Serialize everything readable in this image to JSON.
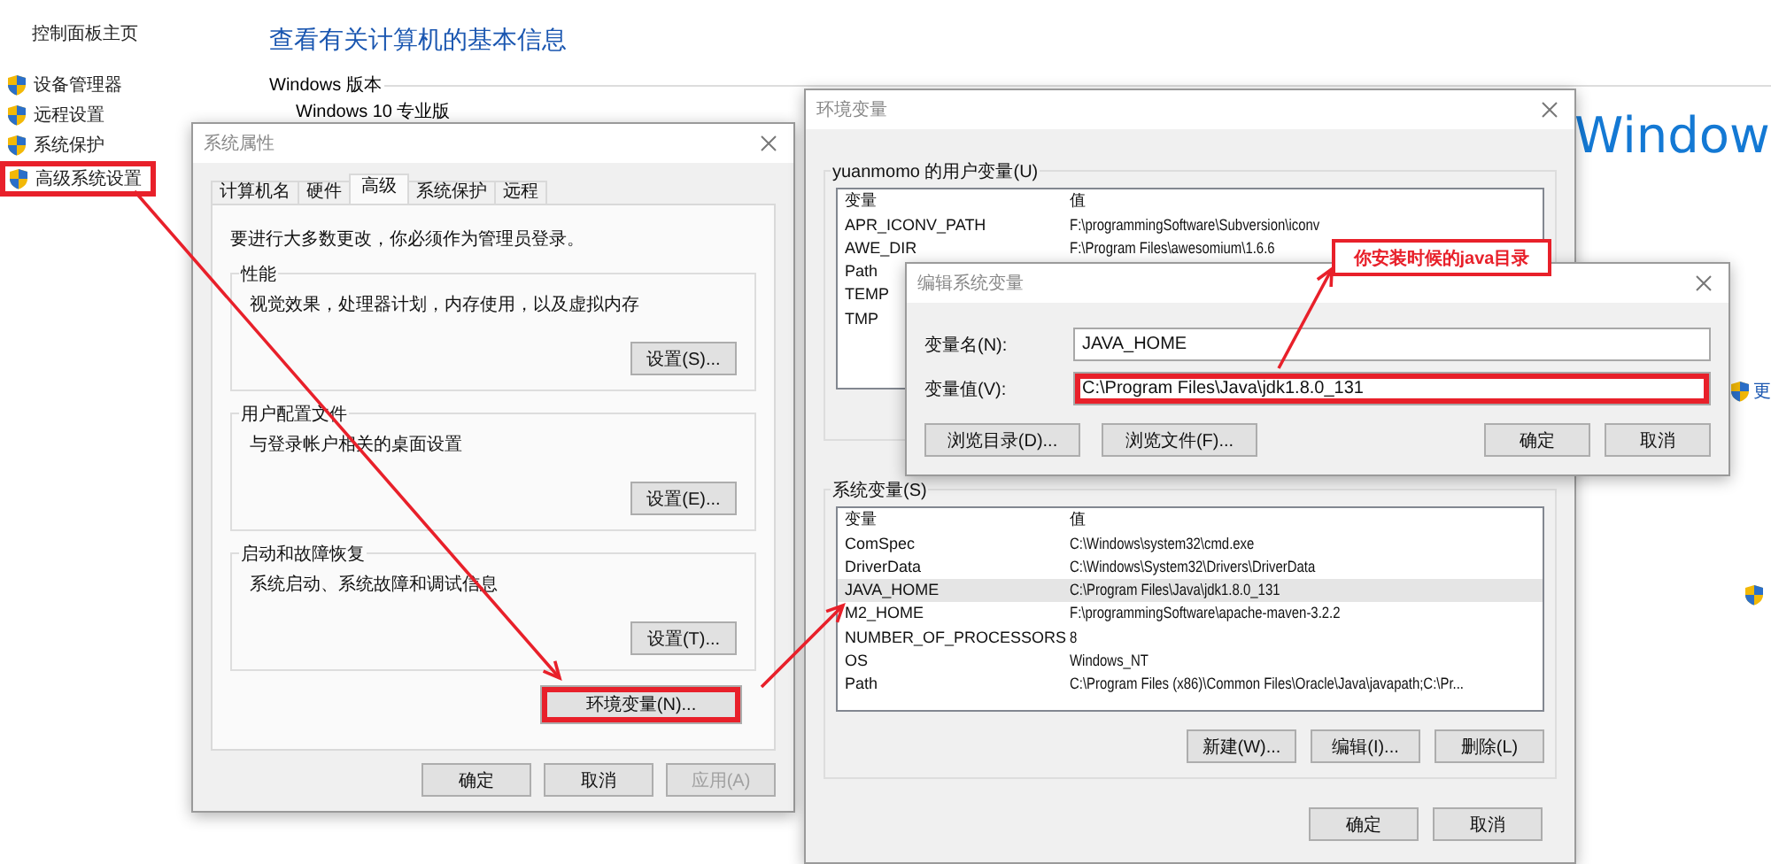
{
  "control_panel": {
    "home_link": "控制面板主页",
    "links": [
      {
        "label": "设备管理器",
        "highlighted": false
      },
      {
        "label": "远程设置",
        "highlighted": false
      },
      {
        "label": "系统保护",
        "highlighted": false
      },
      {
        "label": "高级系统设置",
        "highlighted": true
      }
    ],
    "heading": "查看有关计算机的基本信息",
    "section": "Windows 版本",
    "edition": "Windows 10 专业版",
    "logo_text": "Window",
    "side_link": "更"
  },
  "system_properties": {
    "title": "系统属性",
    "tabs": [
      {
        "label": "计算机名",
        "selected": false
      },
      {
        "label": "硬件",
        "selected": false
      },
      {
        "label": "高级",
        "selected": true
      },
      {
        "label": "系统保护",
        "selected": false
      },
      {
        "label": "远程",
        "selected": false
      }
    ],
    "notice": "要进行大多数更改，你必须作为管理员登录。",
    "groups": [
      {
        "title": "性能",
        "description": "视觉效果，处理器计划，内存使用，以及虚拟内存",
        "button": "设置(S)..."
      },
      {
        "title": "用户配置文件",
        "description": "与登录帐户相关的桌面设置",
        "button": "设置(E)..."
      },
      {
        "title": "启动和故障恢复",
        "description": "系统启动、系统故障和调试信息",
        "button": "设置(T)..."
      }
    ],
    "env_button": {
      "label": "环境变量(N)...",
      "highlighted": true
    },
    "buttons": [
      {
        "label": "确定",
        "disabled": false
      },
      {
        "label": "取消",
        "disabled": false
      },
      {
        "label": "应用(A)",
        "disabled": true
      }
    ]
  },
  "environment_variables": {
    "title": "环境变量",
    "user_group": "yuanmomo 的用户变量(U)",
    "columns": [
      "变量",
      "值"
    ],
    "user_rows": [
      {
        "name": "APR_ICONV_PATH",
        "value": "F:\\programmingSoftware\\Subversion\\iconv"
      },
      {
        "name": "AWE_DIR",
        "value": "F:\\Program Files\\awesomium\\1.6.6"
      },
      {
        "name": "Path"
      },
      {
        "name": "TEMP"
      },
      {
        "name": "TMP"
      }
    ],
    "system_group": "系统变量(S)",
    "system_columns": [
      "变量",
      "值"
    ],
    "system_rows": [
      {
        "name": "ComSpec",
        "value": "C:\\Windows\\system32\\cmd.exe",
        "selected": false
      },
      {
        "name": "DriverData",
        "value": "C:\\Windows\\System32\\Drivers\\DriverData",
        "selected": false
      },
      {
        "name": "JAVA_HOME",
        "value": "C:\\Program Files\\Java\\jdk1.8.0_131",
        "selected": true
      },
      {
        "name": "M2_HOME",
        "value": "F:\\programmingSoftware\\apache-maven-3.2.2",
        "selected": false
      },
      {
        "name": "NUMBER_OF_PROCESSORS",
        "value": "8",
        "selected": false
      },
      {
        "name": "OS",
        "value": "Windows_NT",
        "selected": false
      },
      {
        "name": "Path",
        "value": "C:\\Program Files (x86)\\Common Files\\Oracle\\Java\\javapath;C:\\Pr...",
        "selected": false
      }
    ],
    "system_buttons": [
      "新建(W)...",
      "编辑(I)...",
      "删除(L)"
    ],
    "buttons": [
      "确定",
      "取消"
    ]
  },
  "edit_dialog": {
    "title": "编辑系统变量",
    "fields": [
      {
        "label": "变量名(N):",
        "value": "JAVA_HOME",
        "highlighted": false
      },
      {
        "label": "变量值(V):",
        "value": "C:\\Program Files\\Java\\jdk1.8.0_131",
        "highlighted": true
      }
    ],
    "left_buttons": [
      "浏览目录(D)...",
      "浏览文件(F)..."
    ],
    "right_buttons": [
      "确定",
      "取消"
    ]
  },
  "annotation": "你安装时候的java目录"
}
